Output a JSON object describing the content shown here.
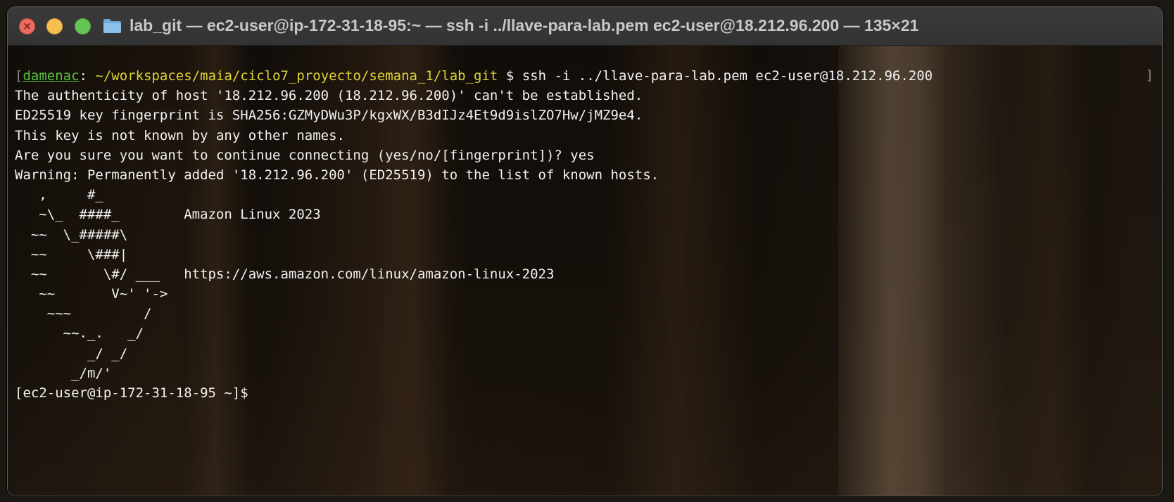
{
  "window": {
    "title": "lab_git — ec2-user@ip-172-31-18-95:~ — ssh -i ../llave-para-lab.pem ec2-user@18.212.96.200 — 135×21",
    "traffic_lights": {
      "close_color": "#ed6a5e",
      "minimize_color": "#f5bf4f",
      "maximize_color": "#62c554",
      "close_glyph": "×"
    },
    "folder_icon": "folder-icon"
  },
  "prompt": {
    "open_bracket": "[",
    "user": "damenac",
    "colon": ": ",
    "path": "~/workspaces/maia/ciclo7_proyecto/semana_1/lab_git",
    "command": " $ ssh -i ../llave-para-lab.pem ec2-user@18.212.96.200",
    "close_bracket": "]"
  },
  "output_lines": [
    "The authenticity of host '18.212.96.200 (18.212.96.200)' can't be established.",
    "ED25519 key fingerprint is SHA256:GZMyDWu3P/kgxWX/B3dIJz4Et9d9islZO7Hw/jMZ9e4.",
    "This key is not known by any other names.",
    "Are you sure you want to continue connecting (yes/no/[fingerprint])? yes",
    "Warning: Permanently added '18.212.96.200' (ED25519) to the list of known hosts.",
    "   ,     #_",
    "   ~\\_  ####_        Amazon Linux 2023",
    "  ~~  \\_#####\\",
    "  ~~     \\###|",
    "  ~~       \\#/ ___   https://aws.amazon.com/linux/amazon-linux-2023",
    "   ~~       V~' '->",
    "    ~~~         /",
    "      ~~._.   _/",
    "         _/ _/",
    "       _/m/'",
    "[ec2-user@ip-172-31-18-95 ~]$ "
  ],
  "colors": {
    "user": "#56c43e",
    "path": "#dcd336",
    "text": "#f2f2f2",
    "bracket": "#8a8a8a"
  }
}
